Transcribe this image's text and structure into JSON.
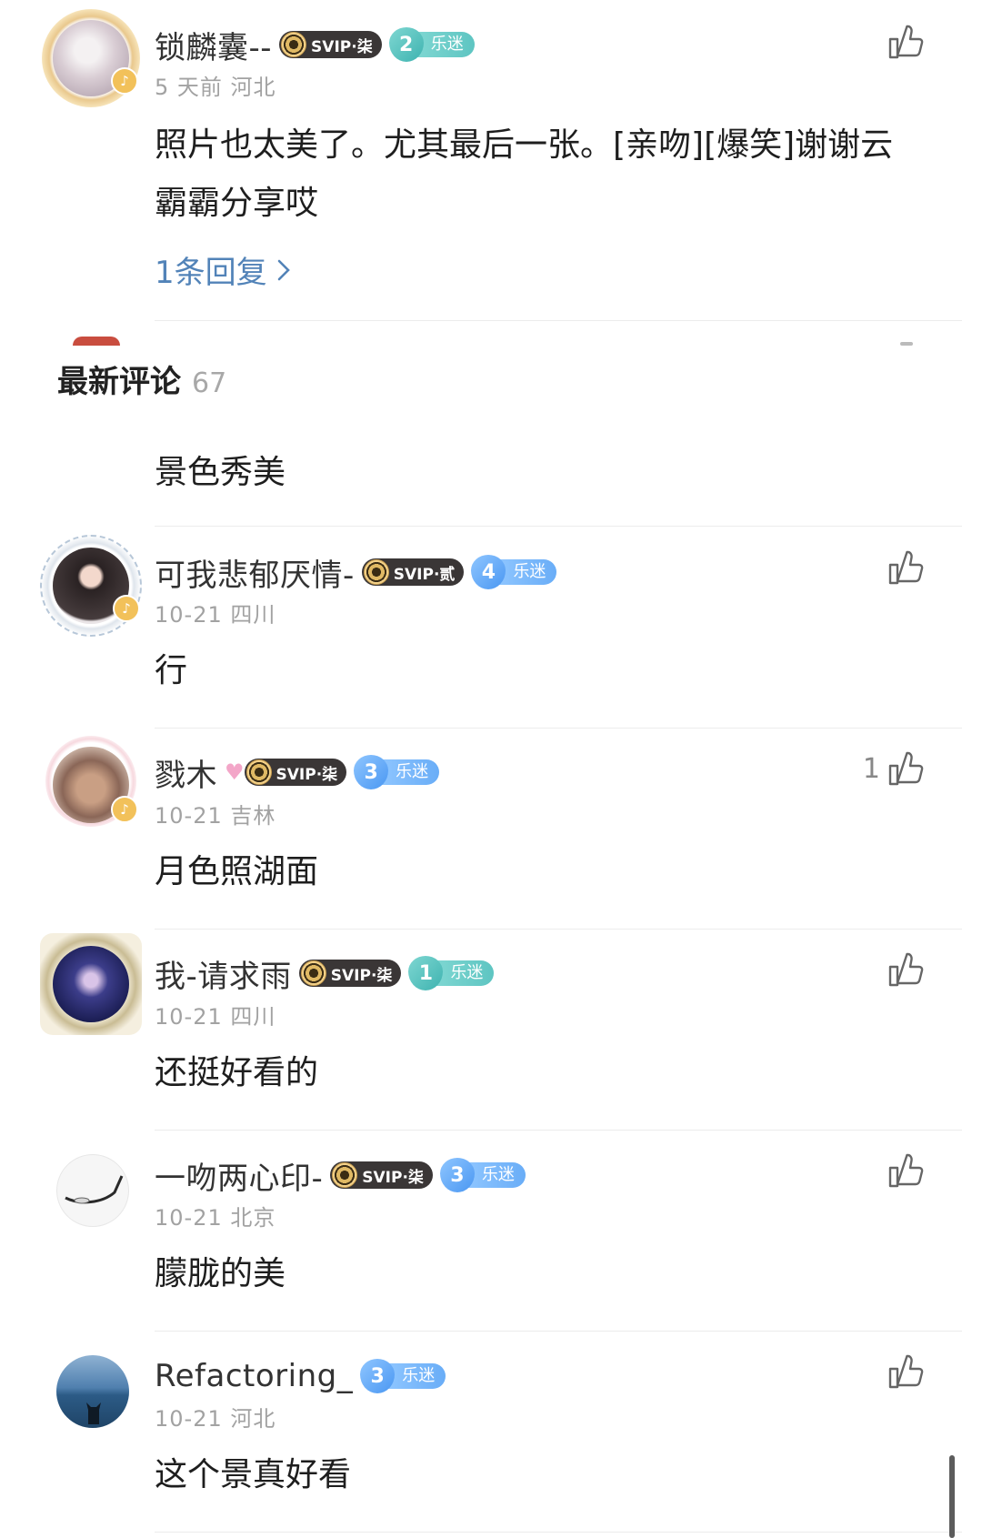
{
  "colors": {
    "accent_link": "#5283b8",
    "meta_gray": "#a2a2a2",
    "svip_bg": "#3a3636"
  },
  "section": {
    "title": "最新评论",
    "count": "67"
  },
  "top_comment": {
    "username": "锁麟囊--",
    "svip": "SVIP·柒",
    "fan_level": "2",
    "fan_label": "乐迷",
    "meta": "5 天前 河北",
    "content": "照片也太美了。尤其最后一张。[亲吻][爆笑]谢谢云霸霸分享哎",
    "reply_link": "1条回复"
  },
  "partial_comment": {
    "content": "景色秀美"
  },
  "comments": [
    {
      "username": "可我悲郁厌情-",
      "svip": "SVIP·贰",
      "fan_level": "4",
      "fan_label": "乐迷",
      "meta": "10-21 四川",
      "content": "行",
      "likes": ""
    },
    {
      "username": "戮木",
      "svip": "SVIP·柒",
      "fan_level": "3",
      "fan_label": "乐迷",
      "meta": "10-21 吉林",
      "content": "月色照湖面",
      "likes": "1"
    },
    {
      "username": "我-请求雨",
      "svip": "SVIP·柒",
      "fan_level": "1",
      "fan_label": "乐迷",
      "meta": "10-21 四川",
      "content": "还挺好看的",
      "likes": ""
    },
    {
      "username": "一吻两心印-",
      "svip": "SVIP·柒",
      "fan_level": "3",
      "fan_label": "乐迷",
      "meta": "10-21 北京",
      "content": "朦胧的美",
      "likes": ""
    },
    {
      "username": "Refactoring_",
      "svip": "",
      "fan_level": "3",
      "fan_label": "乐迷",
      "meta": "10-21 河北",
      "content": "这个景真好看",
      "likes": ""
    }
  ]
}
